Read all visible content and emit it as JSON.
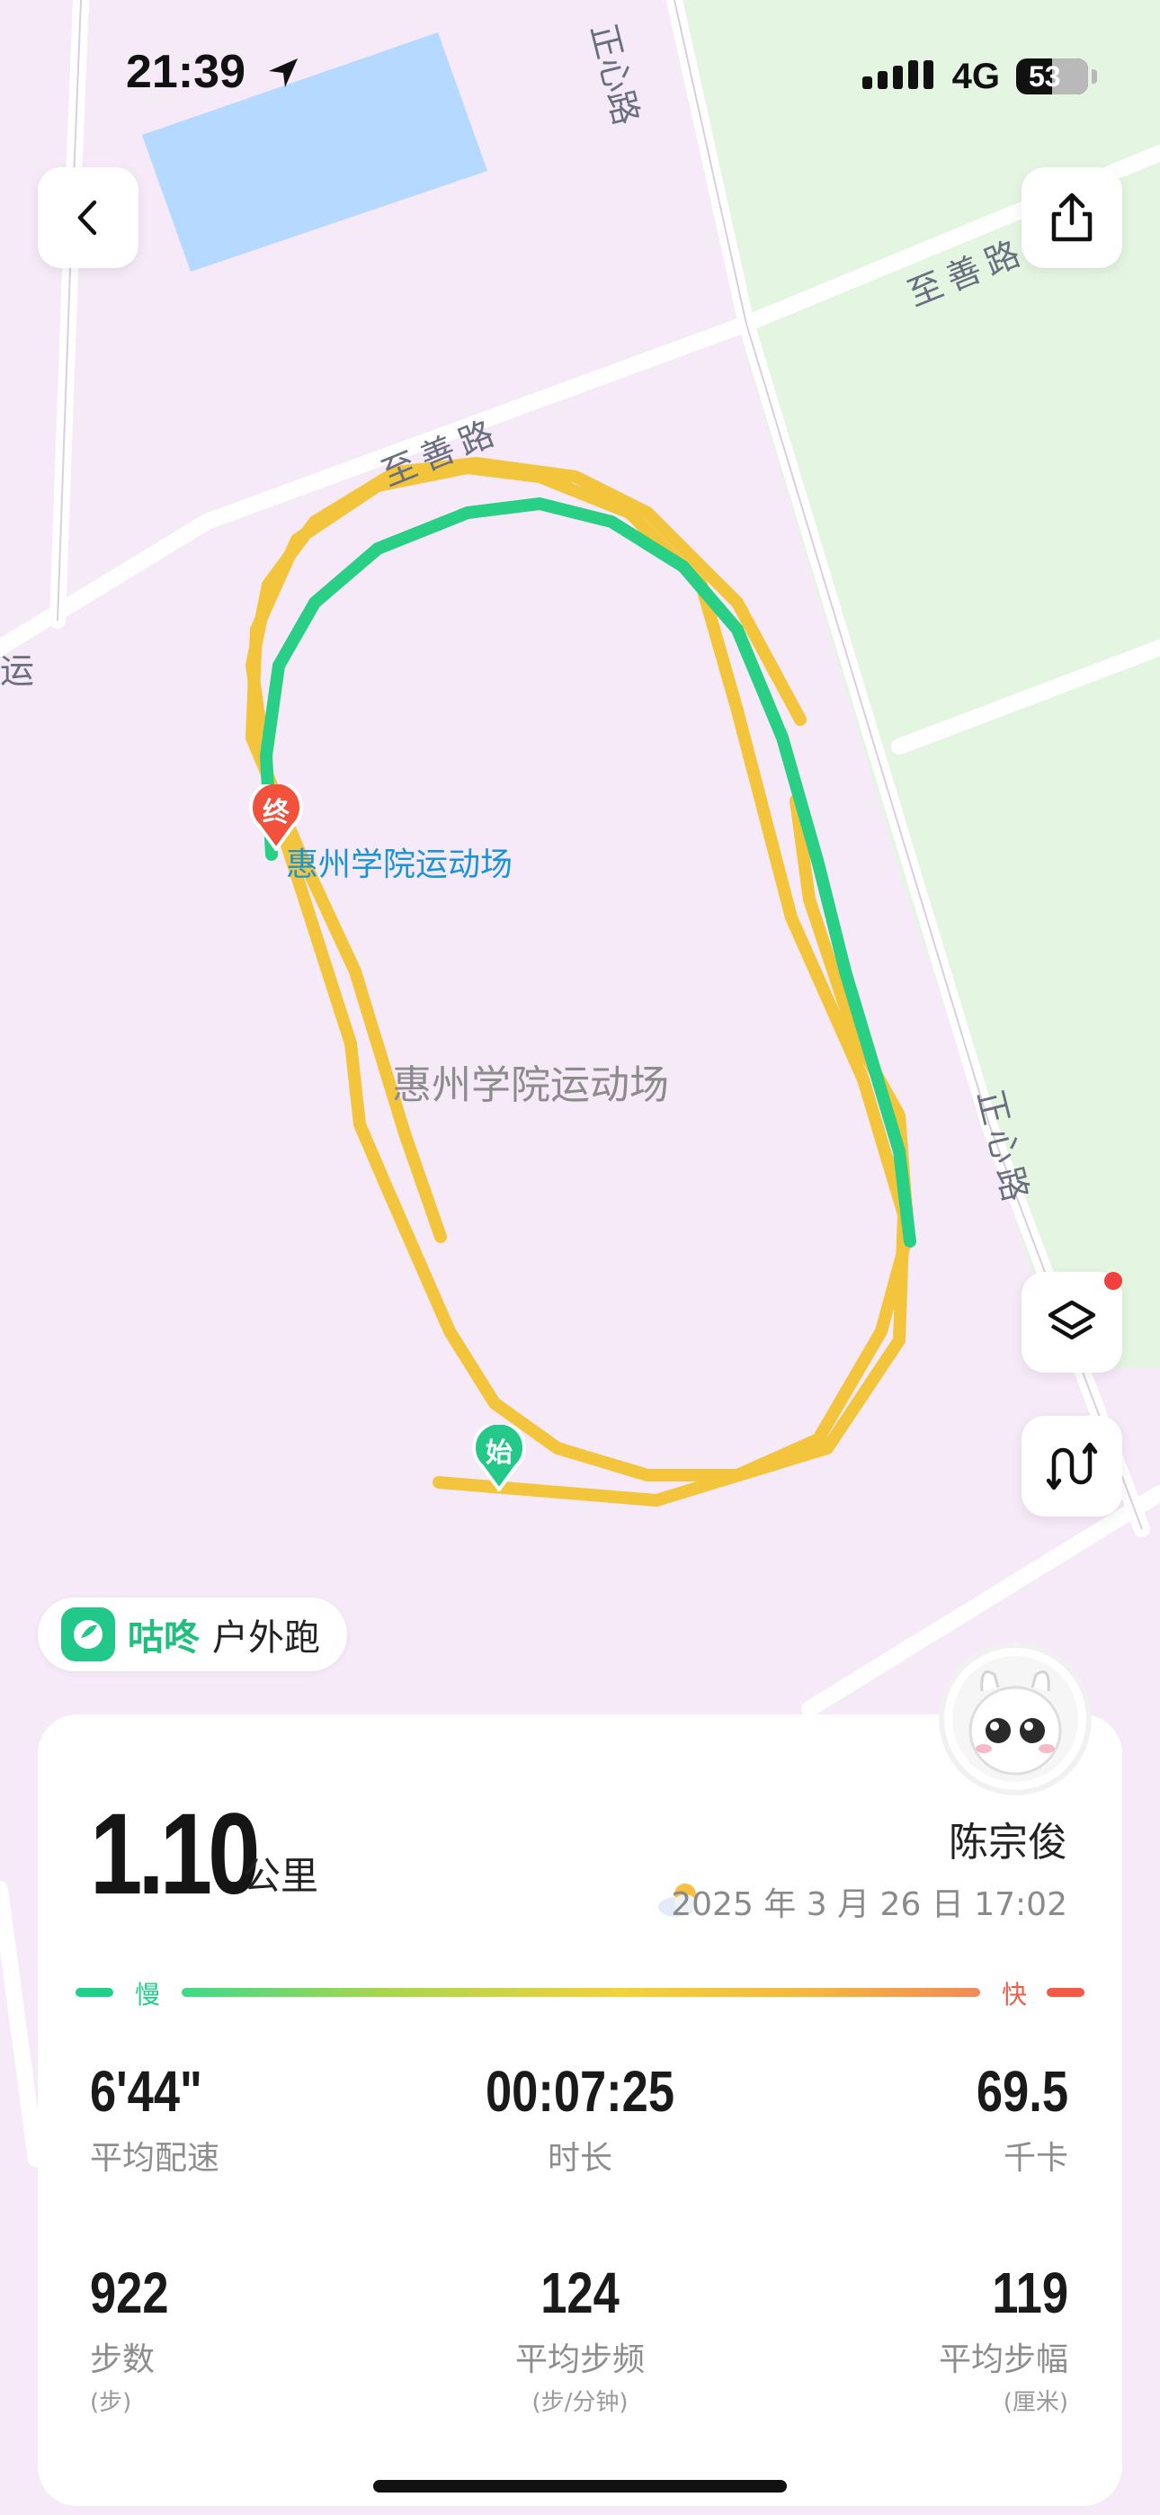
{
  "status_bar": {
    "time": "21:39",
    "network": "4G",
    "battery": "53"
  },
  "map": {
    "roads": [
      "正心路",
      "至善路",
      "至善路",
      "正心路"
    ],
    "partial_label": "运",
    "poi": "惠州学院运动场",
    "area": "惠州学院运动场",
    "start_marker": "始",
    "end_marker": "终"
  },
  "brand": {
    "name": "咕咚",
    "activity": "户外跑"
  },
  "summary": {
    "distance": "1.10",
    "distance_unit": "公里",
    "user": "陈宗俊",
    "datetime": "2025 年 3 月 26 日 17:02"
  },
  "pace_legend": {
    "slow": "慢",
    "fast": "快"
  },
  "stats": [
    {
      "value": "6'44\"",
      "label": "平均配速",
      "unit": ""
    },
    {
      "value": "00:07:25",
      "label": "时长",
      "unit": ""
    },
    {
      "value": "69.5",
      "label": "千卡",
      "unit": ""
    },
    {
      "value": "922",
      "label": "步数",
      "unit": "(步)"
    },
    {
      "value": "124",
      "label": "平均步频",
      "unit": "(步/分钟)"
    },
    {
      "value": "119",
      "label": "平均步幅",
      "unit": "(厘米)"
    }
  ],
  "colors": {
    "slow": "#1fcf8a",
    "mid": "#f2c73c",
    "fast": "#f25a45",
    "brand": "#22c889"
  }
}
